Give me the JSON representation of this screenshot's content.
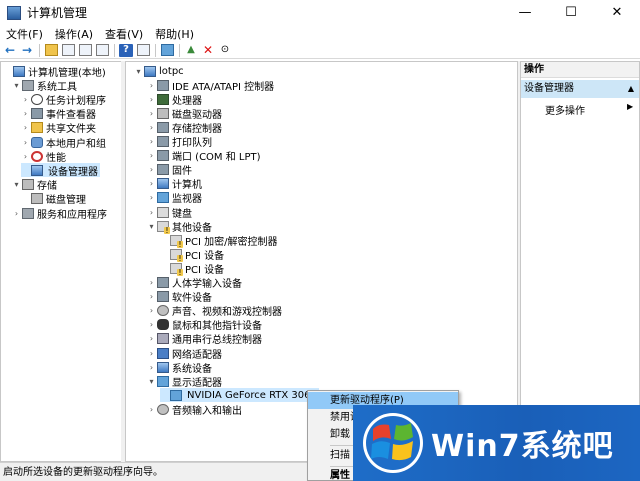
{
  "window": {
    "title": "计算机管理",
    "minimize": "—",
    "maximize": "☐",
    "close": "✕"
  },
  "menu": [
    "文件(F)",
    "操作(A)",
    "查看(V)",
    "帮助(H)"
  ],
  "left_tree": [
    {
      "label": "计算机管理(本地)",
      "icon": "computer-management-icon",
      "exp": "",
      "indent": 0
    },
    {
      "label": "系统工具",
      "icon": "tools-icon",
      "exp": "▾",
      "indent": 1
    },
    {
      "label": "任务计划程序",
      "icon": "clock-icon",
      "exp": "›",
      "indent": 2
    },
    {
      "label": "事件查看器",
      "icon": "event-viewer-icon",
      "exp": "›",
      "indent": 2
    },
    {
      "label": "共享文件夹",
      "icon": "folder-icon",
      "exp": "›",
      "indent": 2
    },
    {
      "label": "本地用户和组",
      "icon": "users-icon",
      "exp": "›",
      "indent": 2
    },
    {
      "label": "性能",
      "icon": "performance-icon",
      "exp": "›",
      "indent": 2
    },
    {
      "label": "设备管理器",
      "icon": "device-manager-icon",
      "exp": "",
      "indent": 2,
      "selected": true
    },
    {
      "label": "存储",
      "icon": "storage-icon",
      "exp": "▾",
      "indent": 1
    },
    {
      "label": "磁盘管理",
      "icon": "disk-icon",
      "exp": "",
      "indent": 2
    },
    {
      "label": "服务和应用程序",
      "icon": "services-icon",
      "exp": "›",
      "indent": 1
    }
  ],
  "device_tree": [
    {
      "label": "lotpc",
      "icon": "computer-icon",
      "exp": "▾",
      "indent": 0
    },
    {
      "label": "IDE ATA/ATAPI 控制器",
      "icon": "ide-controller-icon",
      "exp": "›",
      "indent": 1
    },
    {
      "label": "处理器",
      "icon": "processor-icon",
      "exp": "›",
      "indent": 1
    },
    {
      "label": "磁盘驱动器",
      "icon": "disk-drive-icon",
      "exp": "›",
      "indent": 1
    },
    {
      "label": "存储控制器",
      "icon": "storage-controller-icon",
      "exp": "›",
      "indent": 1
    },
    {
      "label": "打印队列",
      "icon": "printer-icon",
      "exp": "›",
      "indent": 1
    },
    {
      "label": "端口 (COM 和 LPT)",
      "icon": "port-icon",
      "exp": "›",
      "indent": 1
    },
    {
      "label": "固件",
      "icon": "firmware-icon",
      "exp": "›",
      "indent": 1
    },
    {
      "label": "计算机",
      "icon": "computer-icon",
      "exp": "›",
      "indent": 1
    },
    {
      "label": "监视器",
      "icon": "monitor-icon",
      "exp": "›",
      "indent": 1
    },
    {
      "label": "键盘",
      "icon": "keyboard-icon",
      "exp": "›",
      "indent": 1
    },
    {
      "label": "其他设备",
      "icon": "other-devices-icon",
      "exp": "▾",
      "indent": 1
    },
    {
      "label": "PCI 加密/解密控制器",
      "icon": "warning-device-icon",
      "exp": "",
      "indent": 2
    },
    {
      "label": "PCI 设备",
      "icon": "warning-device-icon",
      "exp": "",
      "indent": 2
    },
    {
      "label": "PCI 设备",
      "icon": "warning-device-icon",
      "exp": "",
      "indent": 2
    },
    {
      "label": "人体学输入设备",
      "icon": "hid-icon",
      "exp": "›",
      "indent": 1
    },
    {
      "label": "软件设备",
      "icon": "software-device-icon",
      "exp": "›",
      "indent": 1
    },
    {
      "label": "声音、视频和游戏控制器",
      "icon": "sound-icon",
      "exp": "›",
      "indent": 1
    },
    {
      "label": "鼠标和其他指针设备",
      "icon": "mouse-icon",
      "exp": "›",
      "indent": 1
    },
    {
      "label": "通用串行总线控制器",
      "icon": "usb-icon",
      "exp": "›",
      "indent": 1
    },
    {
      "label": "网络适配器",
      "icon": "network-icon",
      "exp": "›",
      "indent": 1
    },
    {
      "label": "系统设备",
      "icon": "system-device-icon",
      "exp": "›",
      "indent": 1
    },
    {
      "label": "显示适配器",
      "icon": "display-adapter-icon",
      "exp": "▾",
      "indent": 1
    },
    {
      "label": "NVIDIA GeForce RTX 3060",
      "icon": "display-adapter-icon",
      "exp": "",
      "indent": 2,
      "selected": true
    },
    {
      "label": "音频输入和输出",
      "icon": "audio-icon",
      "exp": "›",
      "indent": 1
    }
  ],
  "actions": {
    "header": "操作",
    "active": "设备管理器",
    "more": "更多操作",
    "active_arrow": "▲",
    "more_arrow": "▶"
  },
  "context_menu": [
    {
      "label": "更新驱动程序(P)",
      "highlight": true
    },
    {
      "label": "禁用设备(D)"
    },
    {
      "label": "卸载"
    },
    {
      "label": "扫描"
    },
    {
      "label": "属性",
      "bold": true
    }
  ],
  "status": "启动所选设备的更新驱动程序向导。",
  "watermark": "Win7系统吧"
}
